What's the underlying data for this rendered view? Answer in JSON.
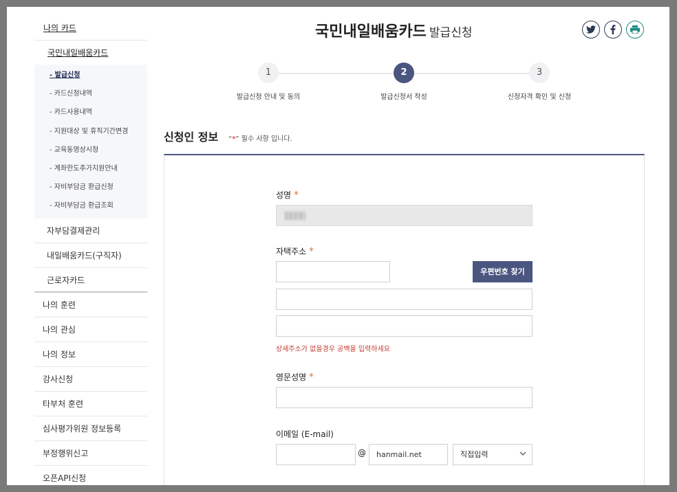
{
  "sidebar": {
    "head": "나의 카드",
    "sub1": "국민내일배움카드",
    "sub1_items": [
      "- 발급신청",
      "- 카드신청내역",
      "- 카드사용내역",
      "- 지원대상 및 휴직기간변경",
      "- 교육동영상시청",
      "- 계좌한도추가지원안내",
      "- 자비부담금 환급신청",
      "- 자비부담금 환급조회"
    ],
    "subs": [
      "자부담결제관리",
      "내일배움카드(구직자)",
      "근로자카드"
    ],
    "tops": [
      "나의 훈련",
      "나의 관심",
      "나의 정보",
      "강사신청",
      "타부처 훈련",
      "심사평가위원 정보등록",
      "부정행위신고",
      "오픈API신청"
    ]
  },
  "header": {
    "title": "국민내일배움카드",
    "subtitle": "발급신청"
  },
  "steps": [
    {
      "num": "1",
      "label": "발급신청 안내 및 동의"
    },
    {
      "num": "2",
      "label": "발급신청서 작성"
    },
    {
      "num": "3",
      "label": "신청자격 확인 및 신청"
    }
  ],
  "section": {
    "title": "신청인 정보",
    "req_open": "“",
    "req_star": "*",
    "req_close": "” 필수 사항 입니다."
  },
  "form": {
    "name_label": "성명",
    "address_label": "자택주소",
    "zip_button": "우편번호 찾기",
    "address_hint": "상세주소가 없을경우 공백을 입력하세요",
    "eng_name_label": "영문성명",
    "email_label": "이메일 (E-mail)",
    "at_sign": "@",
    "email_domain": "hanmail.net",
    "email_select": "직접입력",
    "asterisk": "*"
  }
}
